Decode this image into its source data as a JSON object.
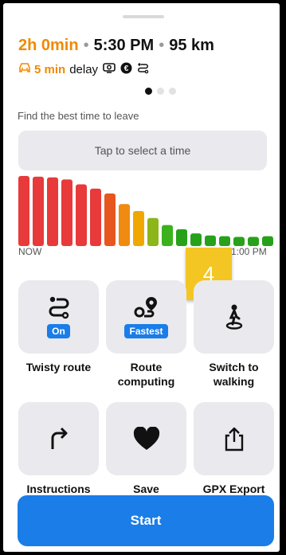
{
  "route_summary": {
    "duration": "2h 0min",
    "separator": "•",
    "arrival": "5:30 PM",
    "distance": "95 km"
  },
  "traffic": {
    "delay_value": "5 min",
    "delay_label": "delay"
  },
  "pager": {
    "total": 3,
    "active": 1
  },
  "departure": {
    "prompt": "Find the best time to leave",
    "placeholder": "Tap to select a time"
  },
  "chart_data": {
    "type": "bar",
    "x_start_label": "NOW",
    "x_end_label": "1:00 PM",
    "values": [
      100,
      99,
      98,
      95,
      88,
      82,
      75,
      60,
      50,
      40,
      30,
      24,
      18,
      15,
      14,
      13,
      13,
      14
    ],
    "colors": [
      "#e83a3a",
      "#e83a3a",
      "#e83a3a",
      "#e83a3a",
      "#e83a3a",
      "#e83a3a",
      "#e6561e",
      "#f08a10",
      "#f0a800",
      "#8cb61a",
      "#3bb11c",
      "#27a11a",
      "#27a11a",
      "#27a11a",
      "#27a11a",
      "#27a11a",
      "#27a11a",
      "#27a11a"
    ]
  },
  "overlay_badge": "4",
  "actions": [
    {
      "label_lines": [
        "Twisty route"
      ],
      "pill": "On",
      "icon": "twisty-route-icon"
    },
    {
      "label_lines": [
        "Route",
        "computing"
      ],
      "pill": "Fastest",
      "icon": "route-computing-icon"
    },
    {
      "label_lines": [
        "Switch to",
        "walking"
      ],
      "pill": "",
      "icon": "walking-icon"
    },
    {
      "label_lines": [
        "Instructions"
      ],
      "pill": "",
      "icon": "turn-right-icon"
    },
    {
      "label_lines": [
        "Save"
      ],
      "pill": "",
      "icon": "heart-icon"
    },
    {
      "label_lines": [
        "GPX Export"
      ],
      "pill": "",
      "icon": "share-icon"
    }
  ],
  "start_button": "Start",
  "colors": {
    "accent": "#1a7de8",
    "delay": "#f08a00"
  }
}
